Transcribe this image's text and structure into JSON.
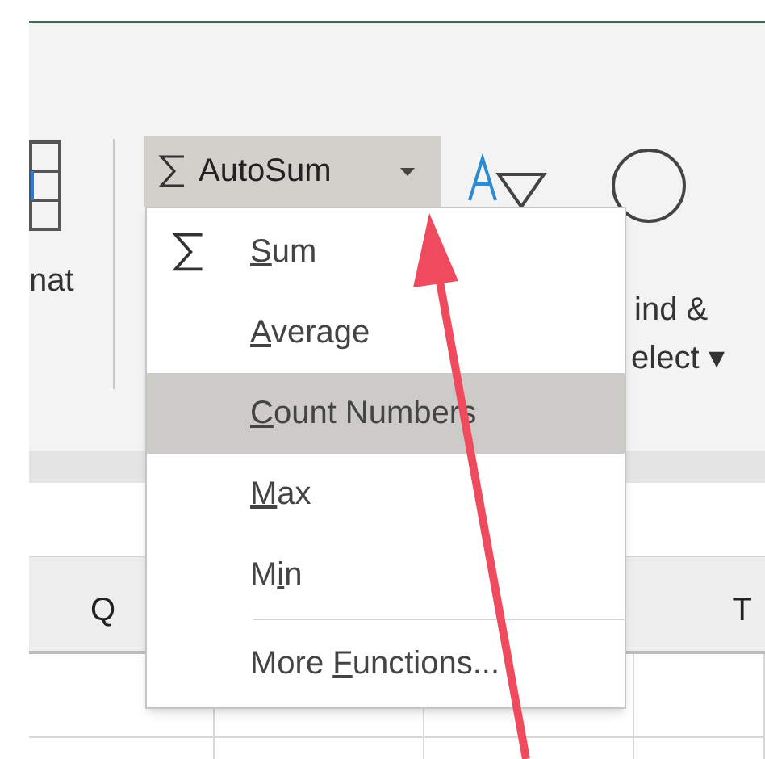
{
  "ribbon": {
    "left_label": "nat",
    "autosum": {
      "label": "AutoSum",
      "open": true
    },
    "find_select": {
      "line1": "ind &",
      "line2": "elect",
      "caret": "▾"
    }
  },
  "menu": {
    "items": [
      {
        "kind": "sigma_item",
        "parts": [
          {
            "text": "S",
            "underlined": true
          },
          {
            "text": "um",
            "underlined": false
          }
        ],
        "selected": false
      },
      {
        "kind": "item",
        "parts": [
          {
            "text": "A",
            "underlined": true
          },
          {
            "text": "verage",
            "underlined": false
          }
        ],
        "selected": false
      },
      {
        "kind": "item",
        "parts": [
          {
            "text": "C",
            "underlined": true
          },
          {
            "text": "ount Numbers",
            "underlined": false
          }
        ],
        "selected": true
      },
      {
        "kind": "item",
        "parts": [
          {
            "text": "M",
            "underlined": true
          },
          {
            "text": "ax",
            "underlined": false
          }
        ],
        "selected": false
      },
      {
        "kind": "item",
        "parts": [
          {
            "text": "M",
            "underlined": false
          },
          {
            "text": "i",
            "underlined": true
          },
          {
            "text": "n",
            "underlined": false
          }
        ],
        "selected": false
      },
      {
        "kind": "separator"
      },
      {
        "kind": "item",
        "parts": [
          {
            "text": "More ",
            "underlined": false
          },
          {
            "text": "F",
            "underlined": true
          },
          {
            "text": "unctions...",
            "underlined": false
          }
        ],
        "selected": false
      }
    ]
  },
  "columns": [
    {
      "label": "Q"
    },
    {
      "label": "T"
    }
  ]
}
